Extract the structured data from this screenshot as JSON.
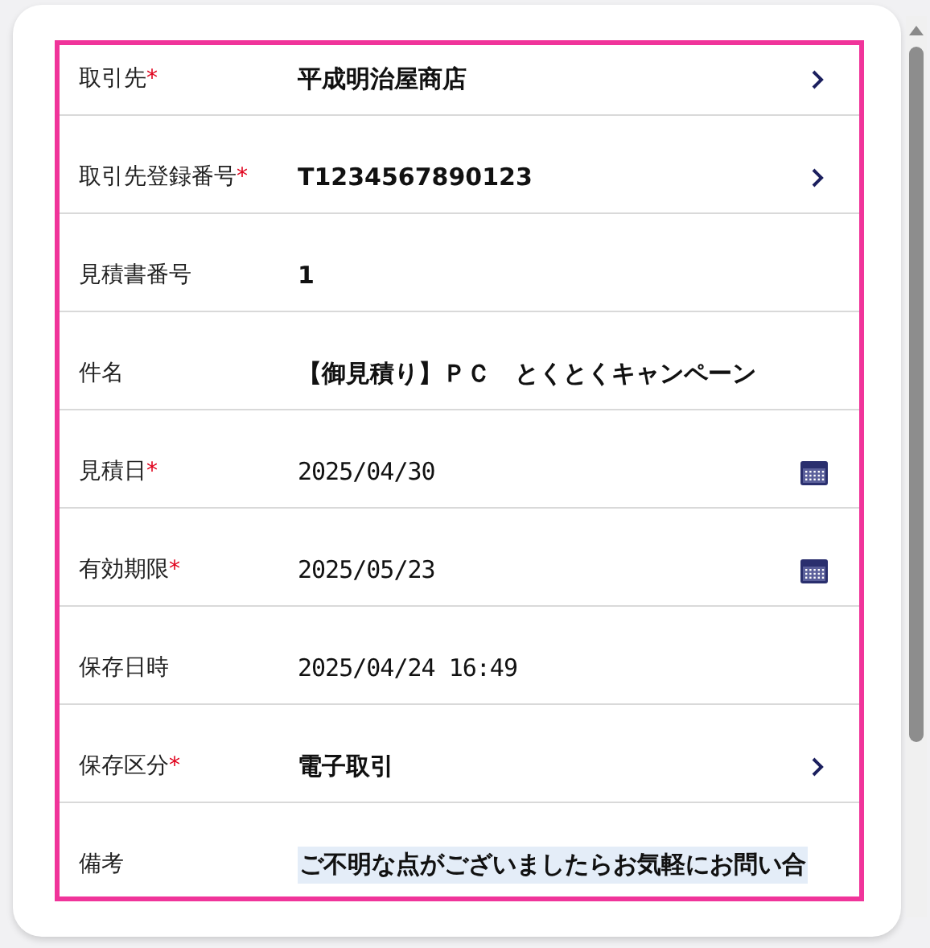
{
  "fields": [
    {
      "label": "取引先",
      "mark": "*",
      "value": "平成明治屋商店",
      "kind": "link",
      "highlighted": false
    },
    {
      "label": "取引先登録番号",
      "mark": "*",
      "value": "T1234567890123",
      "kind": "link",
      "highlighted": false
    },
    {
      "label": "見積書番号",
      "value": "1",
      "kind": "text",
      "highlighted": false
    },
    {
      "label": "件名",
      "value": "【御見積り】ＰＣ　とくとくキャンペーン",
      "kind": "text",
      "highlighted": false
    },
    {
      "label": "見積日",
      "mark": "*",
      "value": "2025/04/30",
      "kind": "date",
      "highlighted": false
    },
    {
      "label": "有効期限",
      "mark": "*",
      "value": "2025/05/23",
      "kind": "date",
      "highlighted": false
    },
    {
      "label": "保存日時",
      "value": "2025/04/24 16:49",
      "kind": "datetime",
      "highlighted": false
    },
    {
      "label": "保存区分",
      "mark": "*",
      "value": "電子取引",
      "kind": "link",
      "highlighted": false
    },
    {
      "label": "備考",
      "value": "ご不明な点がございましたらお気軽にお問い合",
      "kind": "text",
      "highlighted": true
    }
  ]
}
